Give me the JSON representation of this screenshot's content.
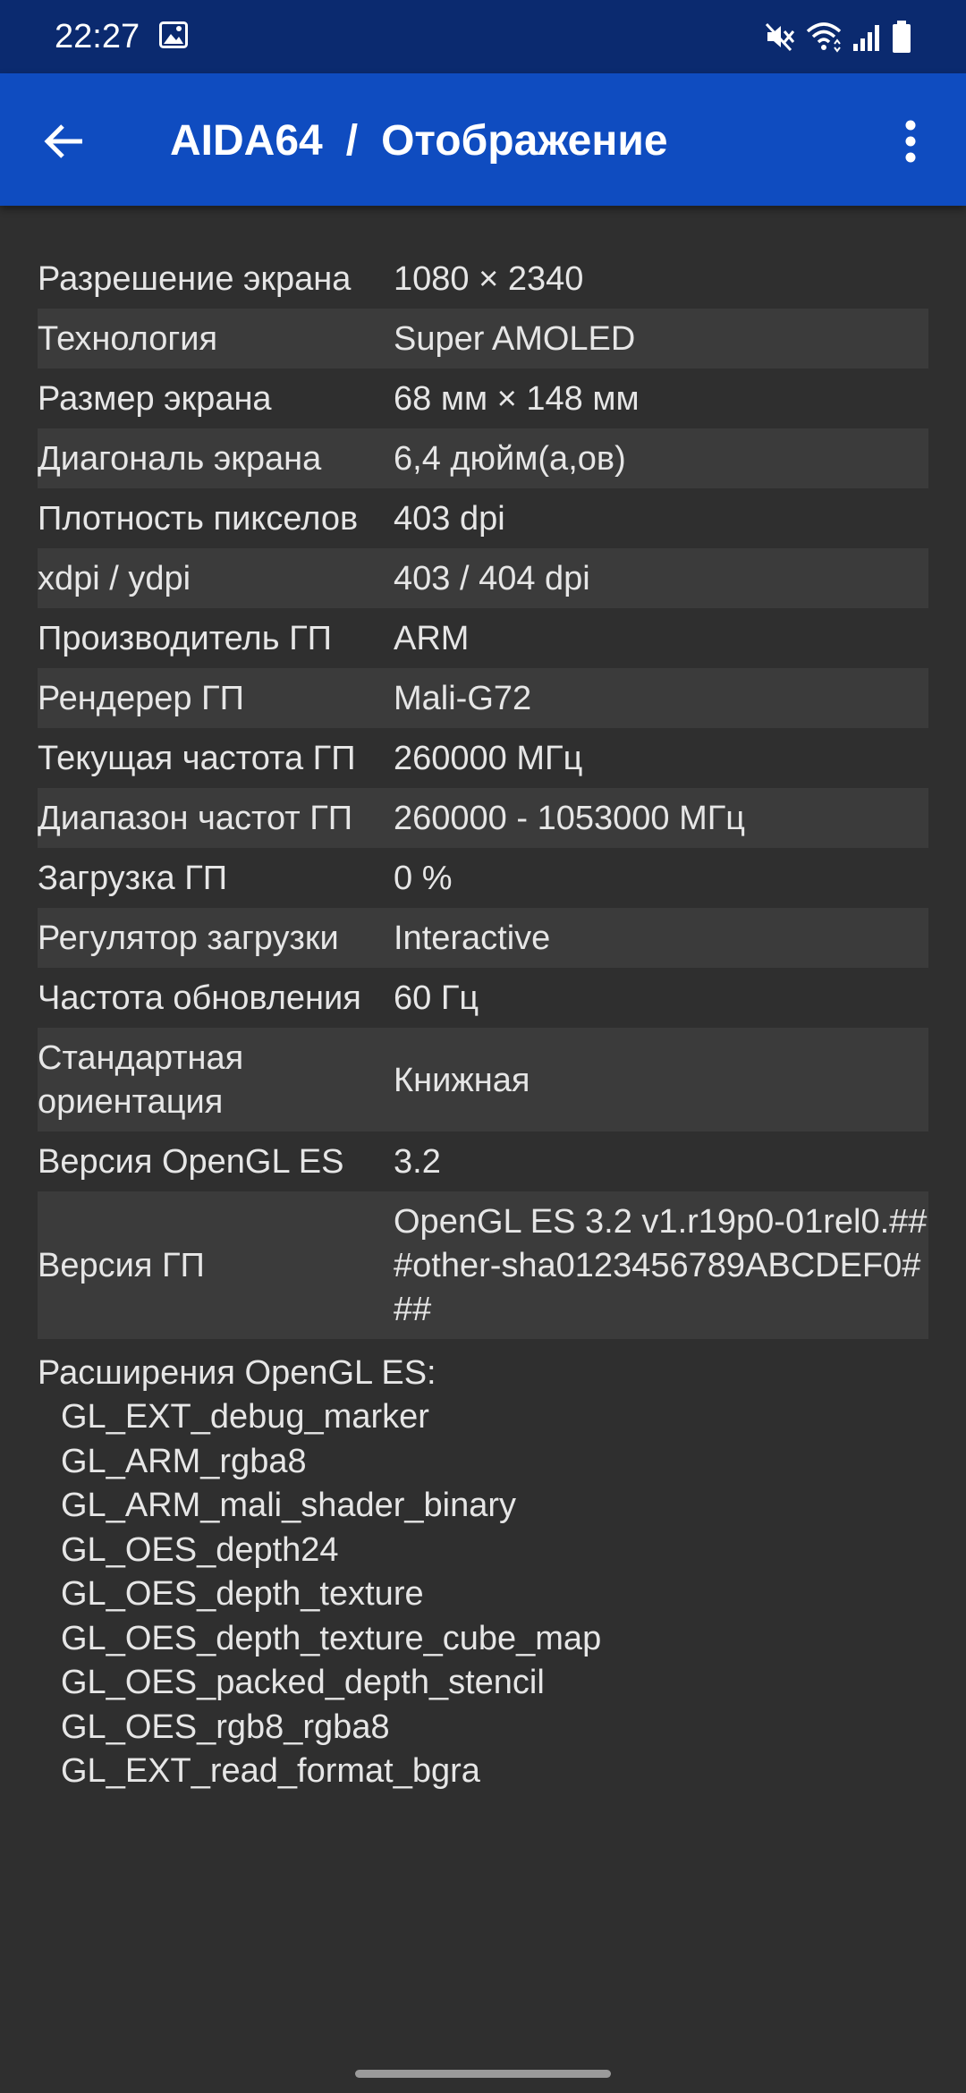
{
  "status_bar": {
    "time": "22:27",
    "icons": [
      "gallery-icon",
      "mute-icon",
      "wifi-icon",
      "signal-icon",
      "battery-icon"
    ]
  },
  "app_bar": {
    "app_name": "AIDA64",
    "separator": "/",
    "page_title": "Отображение",
    "back_icon": "arrow-back-icon",
    "menu_icon": "more-vert-icon"
  },
  "colors": {
    "status_bar_bg": "#0b2a6f",
    "app_bar_bg": "#0f4cc0",
    "content_bg": "#2f2f2f",
    "alt_row_bg": "#3b3b3b",
    "text": "#e6e6e6"
  },
  "rows": [
    {
      "label": "Разрешение экрана",
      "value": "1080 × 2340"
    },
    {
      "label": "Технология",
      "value": "Super AMOLED"
    },
    {
      "label": "Размер экрана",
      "value": "68 мм × 148 мм"
    },
    {
      "label": "Диагональ экрана",
      "value": "6,4 дюйм(а,ов)"
    },
    {
      "label": "Плотность пикселов",
      "value": "403 dpi"
    },
    {
      "label": "xdpi / ydpi",
      "value": "403 / 404 dpi"
    },
    {
      "label": "Производитель ГП",
      "value": "ARM"
    },
    {
      "label": "Рендерер ГП",
      "value": "Mali-G72"
    },
    {
      "label": "Текущая частота ГП",
      "value": "260000 МГц"
    },
    {
      "label": "Диапазон частот ГП",
      "value": "260000 - 1053000 МГц"
    },
    {
      "label": "Загрузка ГП",
      "value": "0 %"
    },
    {
      "label": "Регулятор загрузки",
      "value": "Interactive"
    },
    {
      "label": "Частота обновления",
      "value": "60 Гц"
    },
    {
      "label": "Стандартная ориентация",
      "value": "Книжная"
    },
    {
      "label": "Версия OpenGL ES",
      "value": "3.2"
    },
    {
      "label": "Версия ГП",
      "value": "OpenGL ES 3.2 v1.r19p0-01rel0.###other-sha0123456789ABCDEF0###"
    }
  ],
  "extensions": {
    "title": "Расширения OpenGL ES:",
    "items": [
      "GL_EXT_debug_marker",
      "GL_ARM_rgba8",
      "GL_ARM_mali_shader_binary",
      "GL_OES_depth24",
      "GL_OES_depth_texture",
      "GL_OES_depth_texture_cube_map",
      "GL_OES_packed_depth_stencil",
      "GL_OES_rgb8_rgba8",
      "GL_EXT_read_format_bgra"
    ]
  }
}
